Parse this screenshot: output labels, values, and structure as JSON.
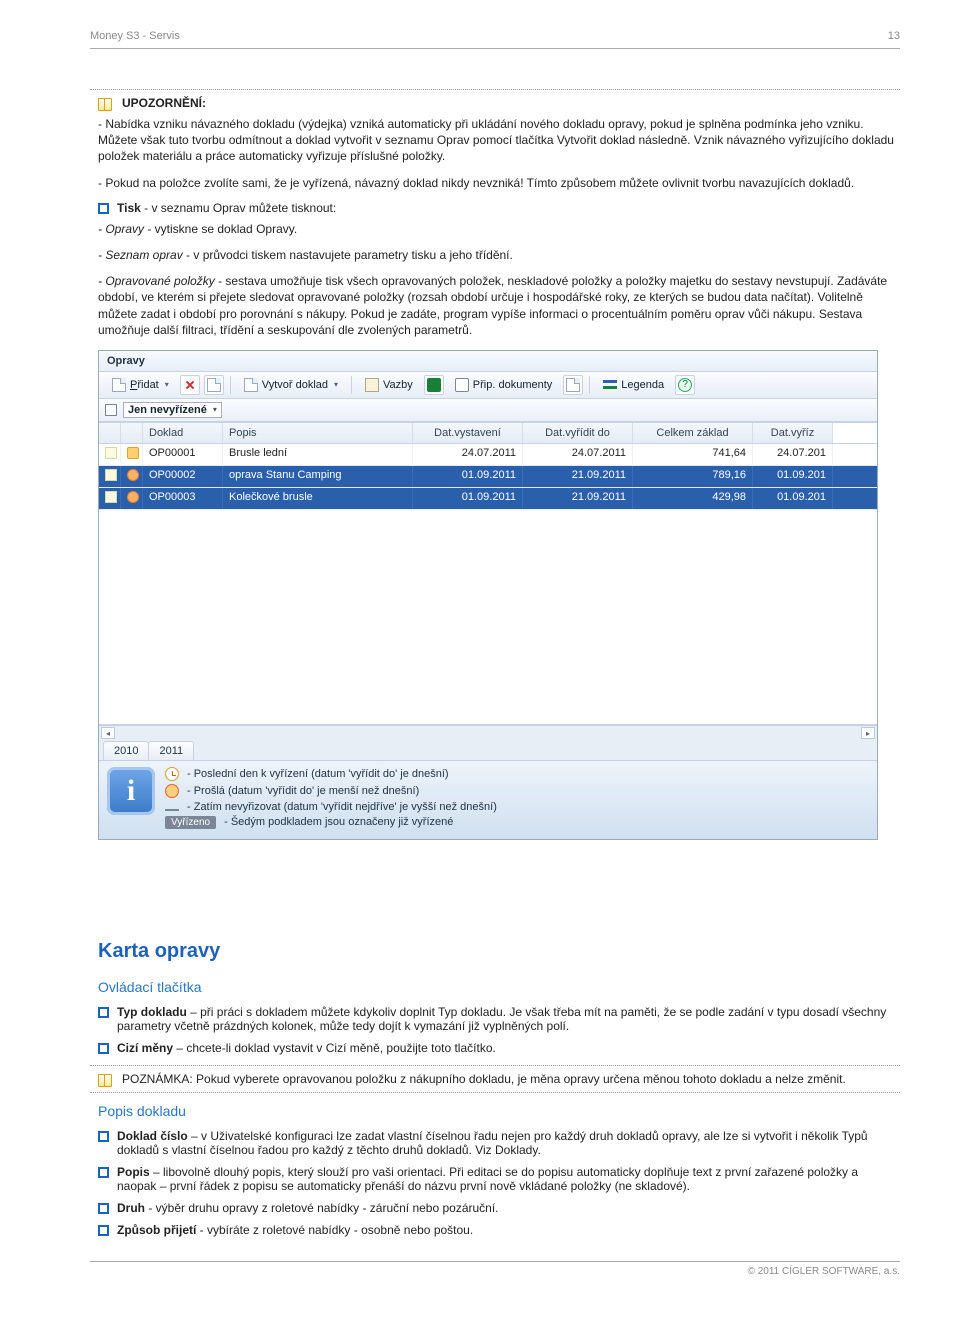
{
  "page_header": {
    "title": "Money S3 - Servis",
    "pageno": "13"
  },
  "upozorneni": {
    "label": "UPOZORNĚNÍ:",
    "p1": "- Nabídka vzniku návazného dokladu (výdejka) vzniká automaticky při ukládání nového dokladu opravy, pokud je splněna podmínka jeho vzniku. Můžete však tuto tvorbu odmítnout a doklad vytvořit v seznamu Oprav pomocí tlačítka Vytvořit doklad následně. Vznik návazného vyřizujícího dokladu položek materiálu a práce automaticky vyřizuje příslušné položky.",
    "p2": "- Pokud na položce zvolíte sami, že je vyřízená, návazný doklad nikdy nevzniká! Tímto způsobem můžete ovlivnit tvorbu navazujících dokladů."
  },
  "tisk": {
    "lead_bold": "Tisk",
    "lead_rest": " - v seznamu Oprav můžete tisknout:",
    "li1_em": "- Opravy",
    "li1_rest": " - vytiskne se doklad Opravy.",
    "li2_em": "- Seznam oprav",
    "li2_rest": " - v průvodci tiskem nastavujete parametry tisku a jeho třídění.",
    "li3_em": "- Opravované položky",
    "li3_rest": " - sestava umožňuje tisk všech opravovaných položek, neskladové položky a položky majetku do sestavy nevstupují. Zadáváte období, ve kterém si přejete sledovat opravované položky (rozsah období určuje i hospodářské roky, ze kterých se budou data načítat). Volitelně můžete zadat i období pro porovnání s nákupy. Pokud je zadáte, program vypíše informaci o procentuálním poměru oprav vůči nákupu. Sestava umožňuje další filtraci, třídění a seskupování dle zvolených parametrů."
  },
  "ui": {
    "window_title": "Opravy",
    "toolbar": {
      "add": "Přidat",
      "create_doc": "Vytvoř doklad",
      "links": "Vazby",
      "attach": "Přip. dokumenty",
      "legend": "Legenda"
    },
    "filter_label": "Jen nevyřízené",
    "columns": [
      "",
      "",
      "Doklad",
      "Popis",
      "Dat.vystavení",
      "Dat.vyřídit do",
      "Celkem základ",
      "Dat.vyříz"
    ],
    "rows": [
      {
        "icon": "clock",
        "doc": "OP00001",
        "popis": "Brusle lední",
        "vyst": "24.07.2011",
        "vyr_do": "24.07.2011",
        "zaklad": "741,64",
        "vyriz": "24.07.201"
      },
      {
        "icon": "flame",
        "doc": "OP00002",
        "popis": "oprava Stanu Camping",
        "vyst": "01.09.2011",
        "vyr_do": "21.09.2011",
        "zaklad": "789,16",
        "vyriz": "01.09.201"
      },
      {
        "icon": "flame",
        "doc": "OP00003",
        "popis": "Kolečkové brusle",
        "vyst": "01.09.2011",
        "vyr_do": "21.09.2011",
        "zaklad": "429,98",
        "vyriz": "01.09.201"
      }
    ],
    "years": [
      "2010",
      "2011"
    ],
    "legend_lines": {
      "l1": "- Poslední den k vyřízení (datum 'vyřídit do' je dnešní)",
      "l2": "- Prošlá (datum 'vyřídit do' je menší než dnešní)",
      "l3": "- Zatím nevyřizovat (datum 'vyřídit nejdříve' je vyšší než dnešní)",
      "l4_badge": "Vyřízeno",
      "l4": "- Šedým podkladem jsou označeny již vyřízené"
    }
  },
  "karta": {
    "h2": "Karta opravy",
    "h3a": "Ovládací tlačítka",
    "b1_bold": "Typ dokladu",
    "b1_rest": " – při práci s dokladem můžete kdykoliv doplnit Typ dokladu. Je však třeba mít na paměti, že se podle zadání v typu dosadí všechny parametry včetně prázdných kolonek, může tedy dojít k vymazání již vyplněných polí.",
    "b2_bold": "Cizí měny",
    "b2_rest": " – chcete-li doklad vystavit v Cizí měně, použijte toto tlačítko.",
    "note_label": "POZNÁMKA: ",
    "note": "Pokud vyberete opravovanou položku z nákupního dokladu, je měna opravy určena měnou tohoto dokladu a nelze změnit.",
    "h3b": "Popis dokladu",
    "c1_bold": "Doklad číslo",
    "c1_rest": " – v Uživatelské konfiguraci lze zadat vlastní číselnou řadu nejen pro každý druh dokladů opravy, ale lze si vytvořit i několik Typů dokladů s vlastní číselnou řadou pro každý z těchto druhů dokladů. Viz Doklady.",
    "c2_bold": "Popis",
    "c2_rest": " – libovolně dlouhý popis, který slouží pro vaši orientaci. Při editaci se do popisu automaticky doplňuje text z první zařazené položky a naopak – první řádek z popisu se automaticky přenáší do názvu první nově vkládané položky (ne skladové).",
    "c3_bold": "Druh",
    "c3_rest": " - výběr druhu opravy z roletové nabídky - záruční nebo pozáruční.",
    "c4_bold": "Způsob přijetí",
    "c4_rest": " - vybíráte z roletové nabídky - osobně nebo poštou."
  },
  "footer": "© 2011 CÍGLER SOFTWARE, a.s."
}
